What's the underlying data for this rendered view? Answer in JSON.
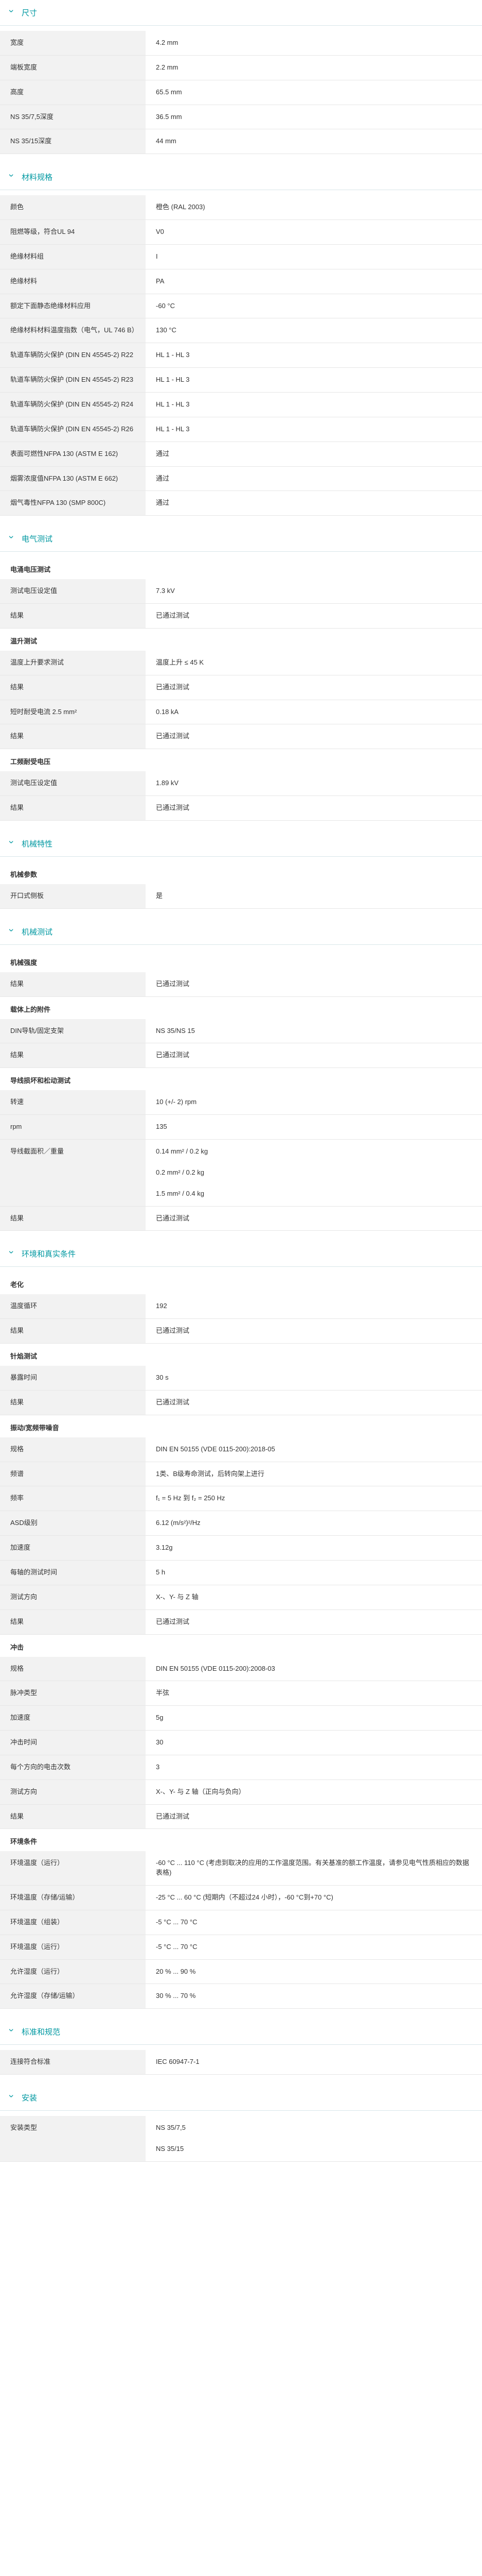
{
  "sections": [
    {
      "title": "尺寸",
      "groups": [
        {
          "title": "",
          "rows": [
            {
              "key": "宽度",
              "values": [
                "4.2 mm"
              ]
            },
            {
              "key": "端板宽度",
              "values": [
                "2.2 mm"
              ]
            },
            {
              "key": "高度",
              "values": [
                "65.5 mm"
              ]
            },
            {
              "key": "NS 35/7,5深度",
              "values": [
                "36.5 mm"
              ]
            },
            {
              "key": "NS 35/15深度",
              "values": [
                "44 mm"
              ]
            }
          ]
        }
      ]
    },
    {
      "title": "材料规格",
      "groups": [
        {
          "title": "",
          "rows": [
            {
              "key": "颜色",
              "values": [
                "橙色 (RAL 2003)"
              ]
            },
            {
              "key": "阻燃等级，符合UL 94",
              "values": [
                "V0"
              ]
            },
            {
              "key": "绝缘材料组",
              "values": [
                "I"
              ]
            },
            {
              "key": "绝缘材料",
              "values": [
                "PA"
              ]
            },
            {
              "key": "额定下面静态绝缘材料应用",
              "values": [
                "-60 °C"
              ]
            },
            {
              "key": "绝缘材料材料温度指数（电气，UL 746 B）",
              "values": [
                "130 °C"
              ]
            },
            {
              "key": "轨道车辆防火保护 (DIN EN 45545-2) R22",
              "values": [
                "HL 1 - HL 3"
              ]
            },
            {
              "key": "轨道车辆防火保护 (DIN EN 45545-2) R23",
              "values": [
                "HL 1 - HL 3"
              ]
            },
            {
              "key": "轨道车辆防火保护 (DIN EN 45545-2) R24",
              "values": [
                "HL 1 - HL 3"
              ]
            },
            {
              "key": "轨道车辆防火保护 (DIN EN 45545-2) R26",
              "values": [
                "HL 1 - HL 3"
              ]
            },
            {
              "key": "表面可燃性NFPA 130 (ASTM E 162)",
              "values": [
                "通过"
              ]
            },
            {
              "key": "烟雾浓度值NFPA 130 (ASTM E 662)",
              "values": [
                "通过"
              ]
            },
            {
              "key": "烟气毒性NFPA 130 (SMP 800C)",
              "values": [
                "通过"
              ]
            }
          ]
        }
      ]
    },
    {
      "title": "电气测试",
      "groups": [
        {
          "title": "电涌电压测试",
          "rows": [
            {
              "key": "测试电压设定值",
              "values": [
                "7.3 kV"
              ]
            },
            {
              "key": "结果",
              "values": [
                "已通过测试"
              ]
            }
          ]
        },
        {
          "title": "温升测试",
          "rows": [
            {
              "key": "温度上升要求测试",
              "values": [
                "温度上升 ≤ 45 K"
              ]
            },
            {
              "key": "结果",
              "values": [
                "已通过测试"
              ]
            },
            {
              "key": "短时耐受电流 2.5 mm²",
              "values": [
                "0.18 kA"
              ]
            },
            {
              "key": "结果",
              "values": [
                "已通过测试"
              ]
            }
          ]
        },
        {
          "title": "工频耐受电压",
          "rows": [
            {
              "key": "测试电压设定值",
              "values": [
                "1.89 kV"
              ]
            },
            {
              "key": "结果",
              "values": [
                "已通过测试"
              ]
            }
          ]
        }
      ]
    },
    {
      "title": "机械特性",
      "groups": [
        {
          "title": "机械参数",
          "rows": [
            {
              "key": "开口式侧板",
              "values": [
                "是"
              ]
            }
          ]
        }
      ]
    },
    {
      "title": "机械测试",
      "groups": [
        {
          "title": "机械强度",
          "rows": [
            {
              "key": "结果",
              "values": [
                "已通过测试"
              ]
            }
          ]
        },
        {
          "title": "载体上的附件",
          "rows": [
            {
              "key": "DIN导轨/固定支架",
              "values": [
                "NS 35/NS 15"
              ]
            },
            {
              "key": "结果",
              "values": [
                "已通过测试"
              ]
            }
          ]
        },
        {
          "title": "导线损坏和松动测试",
          "rows": [
            {
              "key": "转速",
              "values": [
                "10 (+/- 2) rpm"
              ]
            },
            {
              "key": "rpm",
              "values": [
                "135"
              ]
            },
            {
              "key": "导线截面积／重量",
              "values": [
                "0.14 mm² / 0.2 kg",
                "0.2 mm² / 0.2 kg",
                "1.5 mm² / 0.4 kg"
              ]
            },
            {
              "key": "结果",
              "values": [
                "已通过测试"
              ]
            }
          ]
        }
      ]
    },
    {
      "title": "环境和真实条件",
      "groups": [
        {
          "title": "老化",
          "rows": [
            {
              "key": "温度循环",
              "values": [
                "192"
              ]
            },
            {
              "key": "结果",
              "values": [
                "已通过测试"
              ]
            }
          ]
        },
        {
          "title": "针焰测试",
          "rows": [
            {
              "key": "暴露时间",
              "values": [
                "30 s"
              ]
            },
            {
              "key": "结果",
              "values": [
                "已通过测试"
              ]
            }
          ]
        },
        {
          "title": "振动/宽频带噪音",
          "rows": [
            {
              "key": "规格",
              "values": [
                "DIN EN 50155 (VDE 0115-200):2018-05"
              ]
            },
            {
              "key": "频谱",
              "values": [
                "1类、B级寿命测试，后转向架上进行"
              ]
            },
            {
              "key": "频率",
              "values": [
                "f₁ = 5 Hz 到 f₂ = 250 Hz"
              ]
            },
            {
              "key": "ASD级别",
              "values": [
                "6.12 (m/s²)²/Hz"
              ]
            },
            {
              "key": "加速度",
              "values": [
                "3.12g"
              ]
            },
            {
              "key": "每轴的测试时间",
              "values": [
                "5 h"
              ]
            },
            {
              "key": "测试方向",
              "values": [
                "X-、Y- 与 Z 轴"
              ]
            },
            {
              "key": "结果",
              "values": [
                "已通过测试"
              ]
            }
          ]
        },
        {
          "title": "冲击",
          "rows": [
            {
              "key": "规格",
              "values": [
                "DIN EN 50155 (VDE 0115-200):2008-03"
              ]
            },
            {
              "key": "脉冲类型",
              "values": [
                "半弦"
              ]
            },
            {
              "key": "加速度",
              "values": [
                "5g"
              ]
            },
            {
              "key": "冲击时间",
              "values": [
                "30"
              ]
            },
            {
              "key": "每个方向的电击次数",
              "values": [
                "3"
              ]
            },
            {
              "key": "测试方向",
              "values": [
                "X-、Y- 与 Z 轴（正向与负向）"
              ]
            },
            {
              "key": "结果",
              "values": [
                "已通过测试"
              ]
            }
          ]
        },
        {
          "title": "环境条件",
          "rows": [
            {
              "key": "环境温度（运行）",
              "values": [
                "-60 °C ... 110 °C (考虑到取决的应用的工作温度范围。有关基准的额工作温度，请参见电气性质相应的数据表格)"
              ]
            },
            {
              "key": "环境温度（存储/运输）",
              "values": [
                "-25 °C ... 60 °C (短期内（不超过24 小时），-60 °C到+70 °C)"
              ]
            },
            {
              "key": "环境温度（组装）",
              "values": [
                "-5 °C ... 70 °C"
              ]
            },
            {
              "key": "环境温度（运行）",
              "values": [
                "-5 °C ... 70 °C"
              ]
            },
            {
              "key": "允许湿度（运行）",
              "values": [
                "20 % ... 90 %"
              ]
            },
            {
              "key": "允许湿度（存储/运输）",
              "values": [
                "30 % ... 70 %"
              ]
            }
          ]
        }
      ]
    },
    {
      "title": "标准和规范",
      "groups": [
        {
          "title": "",
          "rows": [
            {
              "key": "连接符合标准",
              "values": [
                "IEC 60947-7-1"
              ]
            }
          ]
        }
      ]
    },
    {
      "title": "安装",
      "groups": [
        {
          "title": "",
          "rows": [
            {
              "key": "安装类型",
              "values": [
                "NS 35/7,5",
                "NS 35/15"
              ]
            }
          ]
        }
      ]
    }
  ]
}
